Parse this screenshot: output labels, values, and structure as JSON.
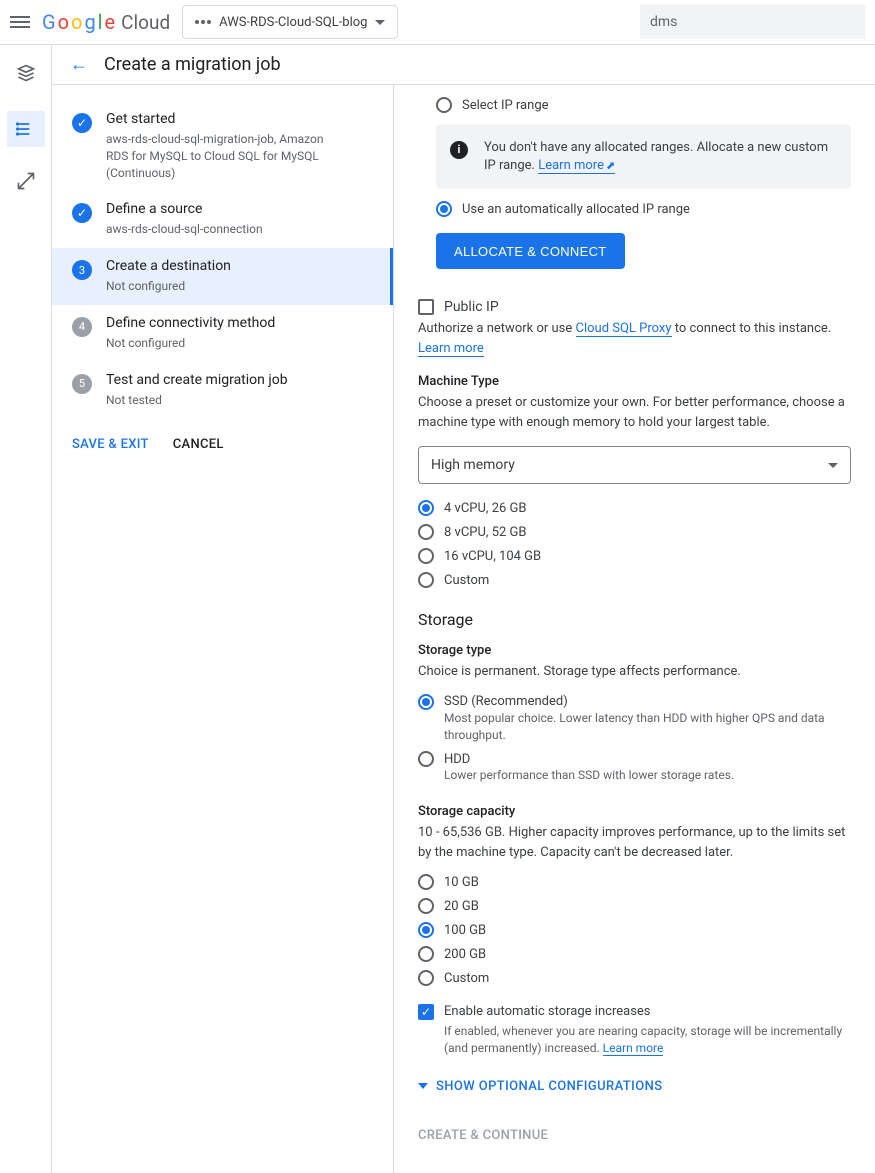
{
  "header": {
    "project_name": "AWS-RDS-Cloud-SQL-blog",
    "search_value": "dms"
  },
  "page": {
    "title": "Create a migration job"
  },
  "steps": [
    {
      "title": "Get started",
      "sub": "aws-rds-cloud-sql-migration-job, Amazon RDS for MySQL to Cloud SQL for MySQL (Continuous)"
    },
    {
      "title": "Define a source",
      "sub": "aws-rds-cloud-sql-connection"
    },
    {
      "title": "Create a destination",
      "sub": "Not configured"
    },
    {
      "title": "Define connectivity method",
      "sub": "Not configured"
    },
    {
      "title": "Test and create migration job",
      "sub": "Not tested"
    }
  ],
  "left_actions": {
    "save_exit": "SAVE & EXIT",
    "cancel": "CANCEL"
  },
  "ip": {
    "select_label": "Select IP range",
    "info_text": "You don't have any allocated ranges. Allocate a new custom IP range. ",
    "learn_more": "Learn more",
    "auto_label": "Use an automatically allocated IP range",
    "allocate_btn": "ALLOCATE & CONNECT"
  },
  "public_ip": {
    "label": "Public IP",
    "auth_text_pre": "Authorize a network or use ",
    "proxy_link": "Cloud SQL Proxy",
    "auth_text_post": " to connect to this instance. ",
    "learn_more": "Learn more"
  },
  "machine": {
    "label": "Machine Type",
    "help": "Choose a preset or customize your own. For better performance, choose a machine type with enough memory to hold your largest table.",
    "select_value": "High memory",
    "options": [
      "4 vCPU, 26 GB",
      "8 vCPU, 52 GB",
      "16 vCPU, 104 GB",
      "Custom"
    ]
  },
  "storage": {
    "heading": "Storage",
    "type_label": "Storage type",
    "type_help": "Choice is permanent. Storage type affects performance.",
    "ssd_label": "SSD (Recommended)",
    "ssd_help": "Most popular choice. Lower latency than HDD with higher QPS and data throughput.",
    "hdd_label": "HDD",
    "hdd_help": "Lower performance than SSD with lower storage rates.",
    "cap_label": "Storage capacity",
    "cap_help": "10 - 65,536 GB. Higher capacity improves performance, up to the limits set by the machine type. Capacity can't be decreased later.",
    "cap_options": [
      "10 GB",
      "20 GB",
      "100 GB",
      "200 GB",
      "Custom"
    ],
    "auto_label": "Enable automatic storage increases",
    "auto_help_pre": "If enabled, whenever you are nearing capacity, storage will be incrementally (and permanently) increased. ",
    "auto_learn": "Learn more"
  },
  "footer": {
    "show_optional": "SHOW OPTIONAL CONFIGURATIONS",
    "create_continue": "CREATE & CONTINUE"
  }
}
